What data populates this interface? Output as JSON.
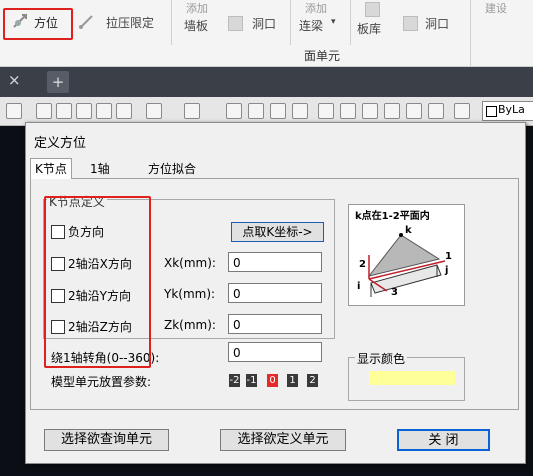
{
  "ribbon": {
    "orient_label": "方位",
    "tension_limit_label": "拉压限定",
    "add_wall_line1": "添加",
    "add_wall_line2": "墙板",
    "hole_label_1": "洞口",
    "link_beam_line1": "添加",
    "link_beam_line2": "连梁",
    "slab_lib_label": "板库",
    "hole_label_2": "洞口",
    "group_label": "面单元",
    "partial_right": "建设"
  },
  "tabs": {
    "close_glyph": "×",
    "add_glyph": "+"
  },
  "toolbar": {
    "bylayer_label": "ByLa"
  },
  "dialog": {
    "title": "定义方位",
    "tabs": [
      "K节点",
      "1轴",
      "方位拟合"
    ],
    "group_title": "K节点定义",
    "checks": [
      "负方向",
      "2轴沿X方向",
      "2轴沿Y方向",
      "2轴沿Z方向"
    ],
    "pick_button": "点取K坐标->",
    "xk_label": "Xk(mm):",
    "yk_label": "Yk(mm):",
    "zk_label": "Zk(mm):",
    "xk_value": "0",
    "yk_value": "0",
    "zk_value": "0",
    "rotate_label": "绕1轴转角(0--360):",
    "rotate_value": "0",
    "placement_label": "模型单元放置参数:",
    "placement_options": [
      "-2",
      "-1",
      "0",
      "1",
      "2"
    ],
    "placement_selected": "0",
    "diagram_title": "k点在1-2平面内",
    "diagram_labels": {
      "k": "k",
      "one": "1",
      "two": "2",
      "three": "3",
      "i": "i",
      "j": "j"
    },
    "color_group_title": "显示颜色",
    "color_swatch": "#ffff99",
    "query_button": "选择欲查询单元",
    "define_button": "选择欲定义单元",
    "close_button": "关  闭"
  }
}
